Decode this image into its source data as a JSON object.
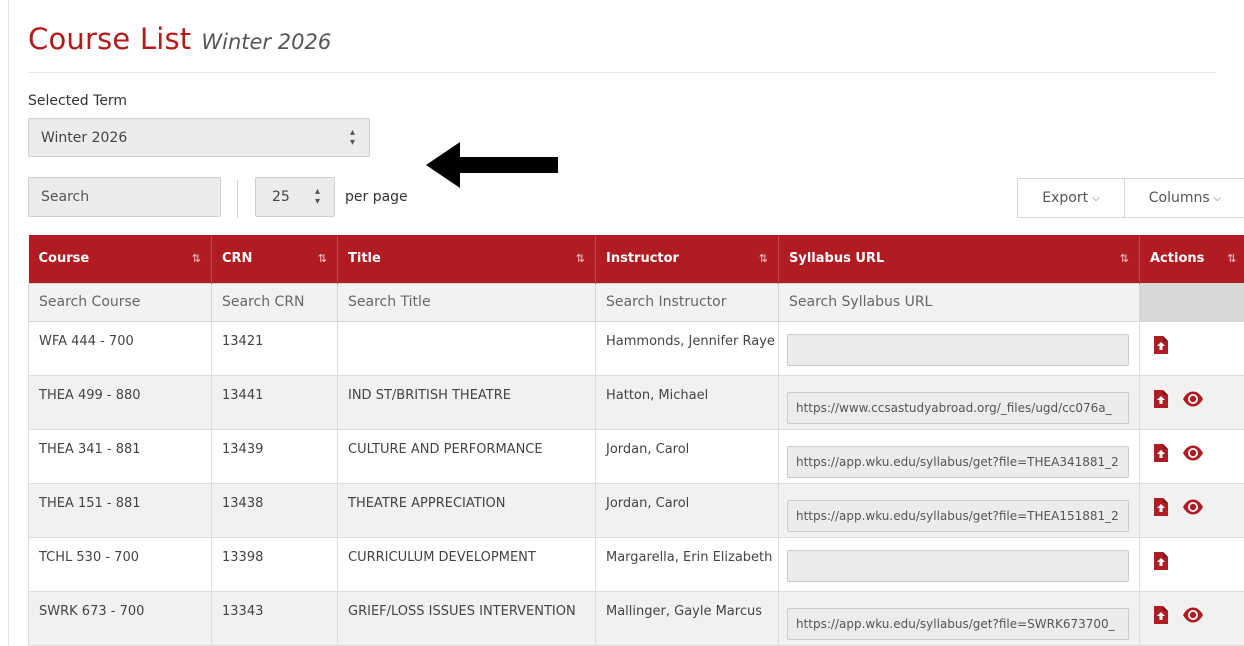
{
  "header": {
    "title": "Course List",
    "subtitle": "Winter 2026"
  },
  "term": {
    "label": "Selected Term",
    "value": "Winter 2026"
  },
  "toolbar": {
    "search_placeholder": "Search",
    "per_page_value": "25",
    "per_page_label": "per page",
    "export_label": "Export",
    "columns_label": "Columns"
  },
  "table": {
    "columns": [
      "Course",
      "CRN",
      "Title",
      "Instructor",
      "Syllabus URL",
      "Actions"
    ],
    "filters": [
      "Search Course",
      "Search CRN",
      "Search Title",
      "Search Instructor",
      "Search Syllabus URL"
    ],
    "rows": [
      {
        "course": "WFA 444 - 700",
        "crn": "13421",
        "title": "",
        "instructor": "Hammonds, Jennifer Raye",
        "url": "",
        "has_view": false
      },
      {
        "course": "THEA 499 - 880",
        "crn": "13441",
        "title": "IND ST/BRITISH THEATRE",
        "instructor": "Hatton, Michael",
        "url": "https://www.ccsastudyabroad.org/_files/ugd/cc076a_",
        "has_view": true
      },
      {
        "course": "THEA 341 - 881",
        "crn": "13439",
        "title": "CULTURE AND PERFORMANCE",
        "instructor": "Jordan, Carol",
        "url": "https://app.wku.edu/syllabus/get?file=THEA341881_2",
        "has_view": true
      },
      {
        "course": "THEA 151 - 881",
        "crn": "13438",
        "title": "THEATRE APPRECIATION",
        "instructor": "Jordan, Carol",
        "url": "https://app.wku.edu/syllabus/get?file=THEA151881_2",
        "has_view": true
      },
      {
        "course": "TCHL 530 - 700",
        "crn": "13398",
        "title": "CURRICULUM DEVELOPMENT",
        "instructor": "Margarella, Erin Elizabeth",
        "url": "",
        "has_view": false
      },
      {
        "course": "SWRK 673 - 700",
        "crn": "13343",
        "title": "GRIEF/LOSS ISSUES INTERVENTION",
        "instructor": "Mallinger, Gayle Marcus",
        "url": "https://app.wku.edu/syllabus/get?file=SWRK673700_",
        "has_view": true
      }
    ]
  },
  "icons": {
    "upload": "file-upload-icon",
    "view": "eye-icon",
    "sort": "sort-icon",
    "annotation": "left-arrow-icon"
  },
  "colors": {
    "brand_red": "#b01c22",
    "title_red": "#b31b1b"
  }
}
